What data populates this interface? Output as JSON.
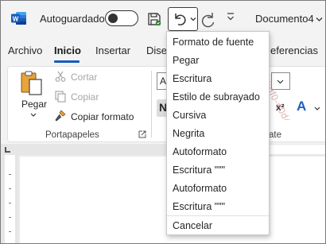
{
  "titlebar": {
    "autosave_label": "Autoguardado",
    "document_title": "Documento4",
    "app_icon": "word-logo-icon"
  },
  "watermark": {
    "text": "1436-bdf0-e0d48dc3b7c8-63d4e6ae4b"
  },
  "tabs": [
    {
      "label": "Archivo",
      "active": false
    },
    {
      "label": "Inicio",
      "active": true
    },
    {
      "label": "Insertar",
      "active": false
    },
    {
      "label": "Dise",
      "active": false
    },
    {
      "label": "eferencias",
      "active": false
    }
  ],
  "ribbon": {
    "clipboard": {
      "paste_label": "Pegar",
      "cut_label": "Cortar",
      "copy_label": "Copiar",
      "format_painter_label": "Copiar formato",
      "group_label": "Portapapeles"
    },
    "font": {
      "font_name_partial": "Ap",
      "bold_partial": "N",
      "superscript_label": "x²",
      "effects_label": "A",
      "group_label_partial": "ate"
    }
  },
  "undo_dropdown": {
    "items": [
      "Formato de fuente",
      "Pegar",
      "Escritura",
      "Estilo de subrayado",
      "Cursiva",
      "Negrita",
      "Autoformato",
      "Escritura \"\"\"",
      "Autoformato",
      "Escritura \"\"\""
    ],
    "cancel_label": "Cancelar"
  },
  "colors": {
    "accent": "#185abd",
    "word_blue": "#185abd",
    "titlebar_bg": "#f3f3f3"
  }
}
